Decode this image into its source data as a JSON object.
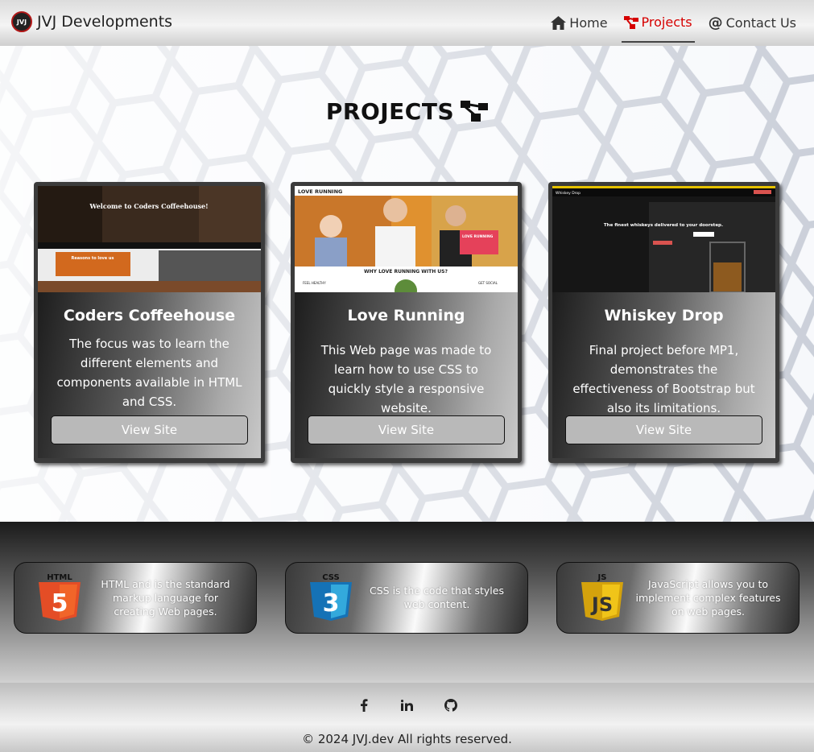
{
  "navbar": {
    "brand_name": "JVJ Developments",
    "logo_text": "JVJ",
    "items": [
      {
        "label": "Home",
        "icon": "home-icon"
      },
      {
        "label": "Projects",
        "icon": "sitemap-icon",
        "active": true
      },
      {
        "label": "Contact Us",
        "icon": "at-icon"
      }
    ],
    "active_color": "#d60000"
  },
  "hero": {
    "title": "PROJECTS",
    "cards": [
      {
        "title": "Coders Coffeehouse",
        "text": "The focus was to learn the different elements and components available in HTML and CSS.",
        "button": "View Site",
        "shot": {
          "heading": "Welcome to Coders Coffeehouse!",
          "banner": "Reasons to love us"
        }
      },
      {
        "title": "Love Running",
        "text": "This Web page was made to learn how to use CSS to quickly style a responsive website.",
        "button": "View Site",
        "shot": {
          "heading": "LOVE RUNNING",
          "banner": "WHY LOVE RUNNING WITH US?",
          "tag": "LOVE RUNNING",
          "left_note": "FEEL HEALTHY",
          "right_note": "GET SOCIAL"
        }
      },
      {
        "title": "Whiskey Drop",
        "text": "Final project before MP1, demonstrates the effectiveness of Bootstrap but also its limitations.",
        "button": "View Site",
        "shot": {
          "heading": "The finest whiskeys delivered to your doorstep.",
          "brand": "Whiskey Drop"
        }
      }
    ]
  },
  "tech": [
    {
      "badge": "HTML",
      "digit": "5",
      "text": "HTML and is the standard markup language for creating Web pages.",
      "color": "#e44d26"
    },
    {
      "badge": "CSS",
      "digit": "3",
      "text": "CSS is the code that styles web content.",
      "color": "#2965f1"
    },
    {
      "badge": "JS",
      "digit": "JS",
      "text": "JavaScript allows you to implement complex features on web pages.",
      "color": "#e5b818"
    }
  ],
  "footer": {
    "socials": [
      "facebook-icon",
      "linkedin-icon",
      "github-icon"
    ],
    "copyright": "© 2024 JVJ.dev All rights reserved."
  }
}
